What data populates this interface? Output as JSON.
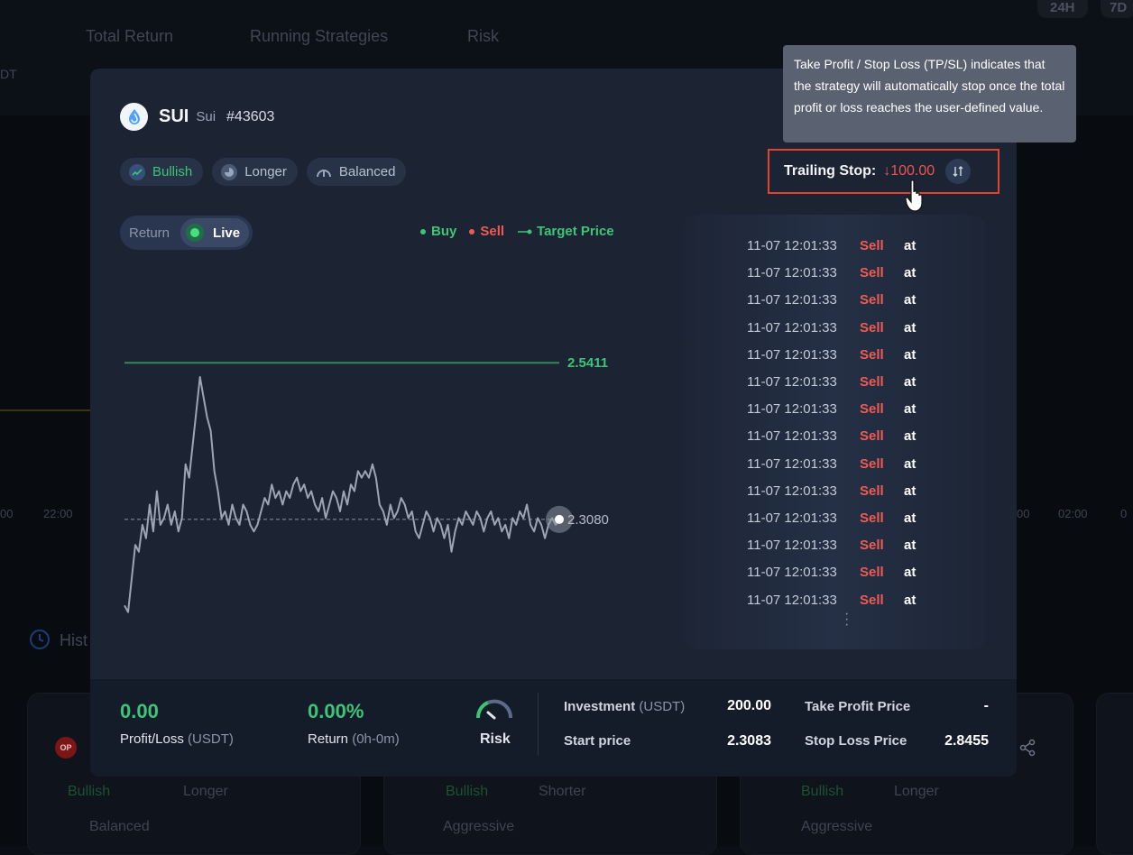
{
  "background": {
    "stats": [
      "Total Return",
      "Running Strategies",
      "Risk"
    ],
    "left_fragment": "DT",
    "time_pills": [
      "24H",
      "7D"
    ],
    "axis_left": [
      "00",
      "22:00"
    ],
    "axis_right": [
      "00",
      "02:00",
      "0"
    ],
    "history_fragment": "Hist",
    "cards": [
      {
        "tag1": "Bullish",
        "tag2": "Longer",
        "tag3": "Balanced",
        "badge": "OP"
      },
      {
        "tag1": "Bullish",
        "tag2": "Shorter",
        "tag3": "Aggressive"
      },
      {
        "tag1": "Bullish",
        "tag2": "Longer",
        "tag3": "Aggressive"
      }
    ]
  },
  "strategy": {
    "symbol": "SUI",
    "name": "Sui",
    "id": "#43603",
    "tags": [
      "Bullish",
      "Longer",
      "Balanced"
    ]
  },
  "trailing_stop": {
    "label": "Trailing Stop:",
    "value": "↓100.00"
  },
  "tooltip": {
    "text": "Take Profit / Stop Loss (TP/SL) indicates that the strategy will automatically stop once the total profit or loss reaches the user-defined value."
  },
  "toggle": {
    "option_return": "Return",
    "option_live": "Live"
  },
  "legend": {
    "buy": "Buy",
    "sell": "Sell",
    "target": "Target Price"
  },
  "chart_data": {
    "type": "line",
    "target_price": 2.5411,
    "target_label": "2.5411",
    "current_price": 2.308,
    "current_label": "2.3080",
    "ylim": [
      2.12,
      2.63
    ],
    "y": [
      2.18,
      2.17,
      2.22,
      2.27,
      2.26,
      2.3,
      2.28,
      2.33,
      2.29,
      2.35,
      2.3,
      2.31,
      2.33,
      2.3,
      2.32,
      2.29,
      2.31,
      2.39,
      2.37,
      2.42,
      2.47,
      2.52,
      2.49,
      2.46,
      2.44,
      2.38,
      2.35,
      2.31,
      2.32,
      2.3,
      2.33,
      2.31,
      2.3,
      2.33,
      2.32,
      2.3,
      2.29,
      2.3,
      2.32,
      2.34,
      2.33,
      2.36,
      2.34,
      2.35,
      2.33,
      2.35,
      2.34,
      2.36,
      2.37,
      2.35,
      2.36,
      2.34,
      2.35,
      2.33,
      2.32,
      2.34,
      2.31,
      2.33,
      2.35,
      2.34,
      2.32,
      2.35,
      2.33,
      2.36,
      2.35,
      2.38,
      2.37,
      2.38,
      2.37,
      2.39,
      2.37,
      2.33,
      2.32,
      2.3,
      2.33,
      2.31,
      2.32,
      2.34,
      2.33,
      2.31,
      2.32,
      2.29,
      2.28,
      2.3,
      2.32,
      2.31,
      2.29,
      2.31,
      2.3,
      2.28,
      2.3,
      2.26,
      2.29,
      2.31,
      2.3,
      2.32,
      2.31,
      2.3,
      2.32,
      2.31,
      2.29,
      2.31,
      2.32,
      2.3,
      2.31,
      2.29,
      2.3,
      2.28,
      2.31,
      2.3,
      2.32,
      2.31,
      2.33,
      2.3,
      2.29,
      2.31,
      2.3,
      2.28,
      2.3,
      2.31,
      2.3,
      2.308
    ]
  },
  "trade_log": {
    "rows": [
      {
        "time": "11-07 12:01:33",
        "side": "Sell",
        "at": "at"
      },
      {
        "time": "11-07 12:01:33",
        "side": "Sell",
        "at": "at"
      },
      {
        "time": "11-07 12:01:33",
        "side": "Sell",
        "at": "at"
      },
      {
        "time": "11-07 12:01:33",
        "side": "Sell",
        "at": "at"
      },
      {
        "time": "11-07 12:01:33",
        "side": "Sell",
        "at": "at"
      },
      {
        "time": "11-07 12:01:33",
        "side": "Sell",
        "at": "at"
      },
      {
        "time": "11-07 12:01:33",
        "side": "Sell",
        "at": "at"
      },
      {
        "time": "11-07 12:01:33",
        "side": "Sell",
        "at": "at"
      },
      {
        "time": "11-07 12:01:33",
        "side": "Sell",
        "at": "at"
      },
      {
        "time": "11-07 12:01:33",
        "side": "Sell",
        "at": "at"
      },
      {
        "time": "11-07 12:01:33",
        "side": "Sell",
        "at": "at"
      },
      {
        "time": "11-07 12:01:33",
        "side": "Sell",
        "at": "at"
      },
      {
        "time": "11-07 12:01:33",
        "side": "Sell",
        "at": "at"
      },
      {
        "time": "11-07 12:01:33",
        "side": "Sell",
        "at": "at"
      }
    ]
  },
  "footer": {
    "profit_value": "0.00",
    "profit_label": "Profit/Loss",
    "profit_unit": "(USDT)",
    "return_value": "0.00%",
    "return_label": "Return",
    "return_unit": "(0h-0m)",
    "risk_label": "Risk",
    "investment_label": "Investment",
    "investment_unit": "(USDT)",
    "investment_value": "200.00",
    "start_price_label": "Start price",
    "start_price_value": "2.3083",
    "take_profit_label": "Take Profit Price",
    "take_profit_value": "-",
    "stop_loss_label": "Stop Loss Price",
    "stop_loss_value": "2.8455"
  },
  "colors": {
    "green": "#3ec477",
    "red": "#ef5b52",
    "modal_bg": "#1c2434",
    "highlight_border": "#e0442e"
  }
}
